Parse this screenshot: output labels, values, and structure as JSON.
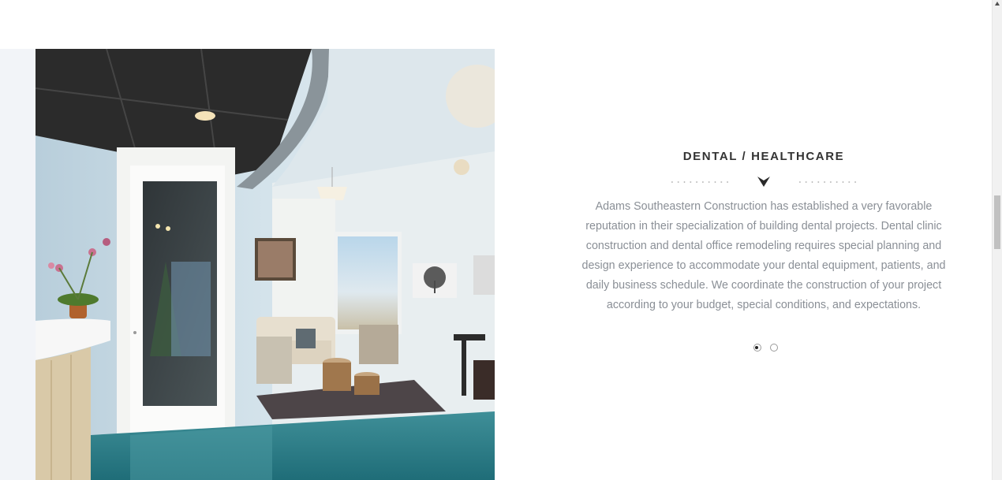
{
  "section": {
    "title": "DENTAL / HEALTHCARE",
    "description": "Adams Southeastern Construction has established a very favorable reputation in their specialization of building dental projects. Dental clinic construction and dental office remodeling requires special planning and design experience to accommodate your dental equipment, patients, and daily business schedule. We coordinate the construction of your project according to your budget, special conditions, and expectations.",
    "divider_icon": "chevron-down-icon"
  },
  "slider": {
    "slides": 2,
    "active_index": 0
  },
  "photo": {
    "subject": "dental-office-waiting-room"
  },
  "colors": {
    "title": "#333333",
    "body_text": "#8a8f96",
    "accent_dot": "#222222"
  }
}
